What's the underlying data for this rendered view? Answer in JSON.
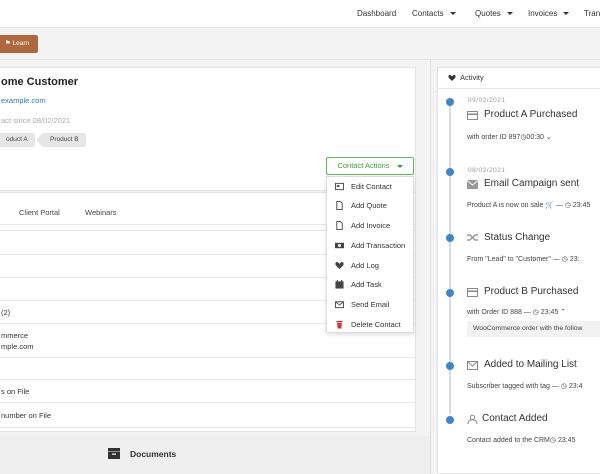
{
  "nav": {
    "items": [
      {
        "label": "Dashboard",
        "has_caret": false
      },
      {
        "label": "Contacts",
        "has_caret": true
      },
      {
        "label": "Quotes",
        "has_caret": true
      },
      {
        "label": "Invoices",
        "has_caret": true
      },
      {
        "label": "Trans",
        "has_caret": false
      }
    ]
  },
  "learn_button": {
    "label": "Learn",
    "icon": "graduation-cap-icon",
    "color": "#b0683f"
  },
  "customer": {
    "name": "ome Customer",
    "email": "example.com",
    "since": "act since 08/02/2021",
    "tags": [
      "oduct A",
      "Product B"
    ]
  },
  "contact_actions": {
    "button_label": "Contact Actions",
    "accent": "#3f9a3f",
    "menu": [
      {
        "label": "Edit Contact",
        "icon": "id-card-icon"
      },
      {
        "label": "Add Quote",
        "icon": "file-icon"
      },
      {
        "label": "Add Invoice",
        "icon": "file-icon"
      },
      {
        "label": "Add Transaction",
        "icon": "money-icon"
      },
      {
        "label": "Add Log",
        "icon": "heart-icon"
      },
      {
        "label": "Add Task",
        "icon": "calendar-icon"
      },
      {
        "label": "Send Email",
        "icon": "envelope-icon"
      },
      {
        "label": "Delete Contact",
        "icon": "trash-icon",
        "color": "#d23a3a"
      }
    ]
  },
  "tabs": [
    "Client Portal",
    "Webinars"
  ],
  "rows": [
    {
      "lines": [
        ""
      ]
    },
    {
      "lines": [
        ""
      ]
    },
    {
      "lines": [
        ""
      ]
    },
    {
      "lines": [
        "(2)"
      ]
    },
    {
      "lines": [
        "mmerce",
        "mple.com"
      ]
    },
    {
      "lines": [
        ""
      ]
    },
    {
      "lines": [
        "s on File"
      ]
    },
    {
      "lines": [
        "number on File"
      ]
    }
  ],
  "documents": {
    "label": "Documents",
    "icon": "folder-icon"
  },
  "activity": {
    "title": "Activity",
    "icon": "heart-icon",
    "accent": "#3f86c7",
    "events": [
      {
        "date": "09/02/2021",
        "title": "Product A Purchased",
        "icon": "credit-card-icon",
        "desc": "with order ID 897",
        "time": "00:30",
        "chevron": "down"
      },
      {
        "date": "08/02/2021",
        "title": "Email Campaign sent",
        "icon": "envelope-icon",
        "desc": "Product A is now on sale",
        "time": "23:45",
        "chevron": ""
      },
      {
        "date": "",
        "title": "Status Change",
        "icon": "random-icon",
        "desc": "From \"Lead\" to \"Customer\" —",
        "time": "23:",
        "chevron": ""
      },
      {
        "date": "",
        "title": "Product B Purchased",
        "icon": "credit-card-icon",
        "desc": "with Order ID 888 —",
        "time": "23:45",
        "chevron": "up",
        "note": "WooCommerce order with the follow"
      },
      {
        "date": "",
        "title": "Added to Mailing List",
        "icon": "envelope-outline-icon",
        "desc": "Subscriber tagged with tag —",
        "time": "23:4",
        "chevron": ""
      },
      {
        "date": "",
        "title": "Contact Added",
        "icon": "user-icon",
        "desc": "Contact added to the CRM",
        "time": "23:45",
        "chevron": ""
      }
    ]
  }
}
